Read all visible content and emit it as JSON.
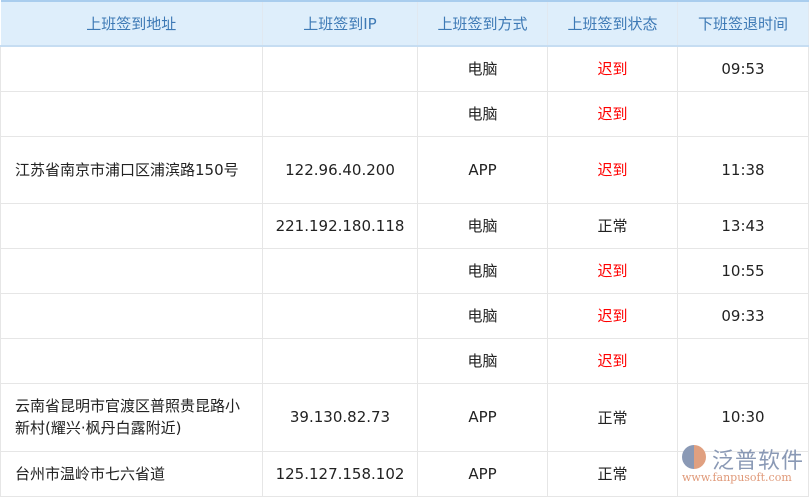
{
  "headers": [
    "上班签到地址",
    "上班签到IP",
    "上班签到方式",
    "上班签到状态",
    "下班签退时间"
  ],
  "rows": [
    {
      "addr": "",
      "ip": "",
      "method": "电脑",
      "status": "迟到",
      "late": true,
      "time": "09:53",
      "h": 45
    },
    {
      "addr": "",
      "ip": "",
      "method": "电脑",
      "status": "迟到",
      "late": true,
      "time": "",
      "h": 45
    },
    {
      "addr": "江苏省南京市浦口区浦滨路150号",
      "ip": "122.96.40.200",
      "method": "APP",
      "status": "迟到",
      "late": true,
      "time": "11:38",
      "h": 67
    },
    {
      "addr": "",
      "ip": "221.192.180.118",
      "method": "电脑",
      "status": "正常",
      "late": false,
      "time": "13:43",
      "h": 45
    },
    {
      "addr": "",
      "ip": "",
      "method": "电脑",
      "status": "迟到",
      "late": true,
      "time": "10:55",
      "h": 45
    },
    {
      "addr": "",
      "ip": "",
      "method": "电脑",
      "status": "迟到",
      "late": true,
      "time": "09:33",
      "h": 45
    },
    {
      "addr": "",
      "ip": "",
      "method": "电脑",
      "status": "迟到",
      "late": true,
      "time": "",
      "h": 45
    },
    {
      "addr": "云南省昆明市官渡区普照贵昆路小新村(耀兴·枫丹白露附近)",
      "ip": "39.130.82.73",
      "method": "APP",
      "status": "正常",
      "late": false,
      "time": "10:30",
      "h": 68
    },
    {
      "addr": "台州市温岭市七六省道",
      "ip": "125.127.158.102",
      "method": "APP",
      "status": "正常",
      "late": false,
      "time": "",
      "h": 45
    }
  ],
  "watermark": {
    "brand": "泛普软件",
    "url": "www.fanpusoft.com"
  }
}
